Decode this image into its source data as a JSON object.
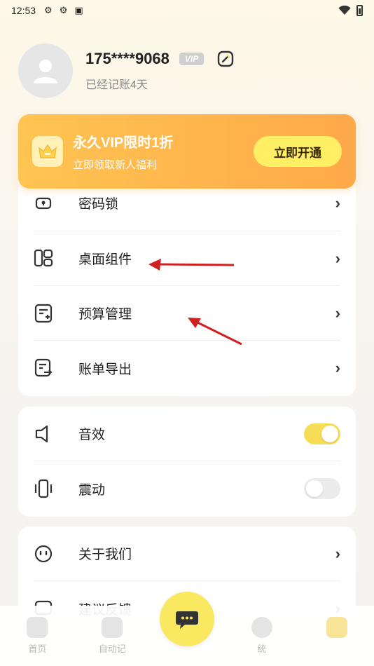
{
  "status_bar": {
    "time": "12:53",
    "icons": [
      "app-icon",
      "app-icon",
      "a-icon"
    ],
    "right_icons": [
      "wifi-icon",
      "battery-icon"
    ]
  },
  "profile": {
    "phone": "175****9068",
    "vip_tag": "VIP",
    "days_text": "已经记账4天"
  },
  "vip_banner": {
    "title": "永久VIP限时1折",
    "subtitle": "立即领取新人福利",
    "button": "立即开通"
  },
  "menu_card": {
    "items": [
      {
        "label": "密码锁",
        "icon": "lock-icon"
      },
      {
        "label": "桌面组件",
        "icon": "widget-icon"
      },
      {
        "label": "预算管理",
        "icon": "budget-icon"
      },
      {
        "label": "账单导出",
        "icon": "export-icon"
      }
    ]
  },
  "settings_card": {
    "items": [
      {
        "label": "音效",
        "icon": "speaker-icon",
        "enabled": true
      },
      {
        "label": "震动",
        "icon": "vibrate-icon",
        "enabled": false
      }
    ]
  },
  "about_card": {
    "items": [
      {
        "label": "关于我们",
        "icon": "smile-icon"
      },
      {
        "label": "建议反馈",
        "icon": "feedback-icon"
      }
    ]
  },
  "tabbar": {
    "tabs": [
      {
        "label": "首页"
      },
      {
        "label": "自动记"
      },
      {
        "label": ""
      },
      {
        "label": "统"
      },
      {
        "label": ""
      }
    ]
  },
  "colors": {
    "accent_yellow": "#f7dc55",
    "banner_orange": "#ffa94a",
    "arrow_red": "#d02020"
  }
}
